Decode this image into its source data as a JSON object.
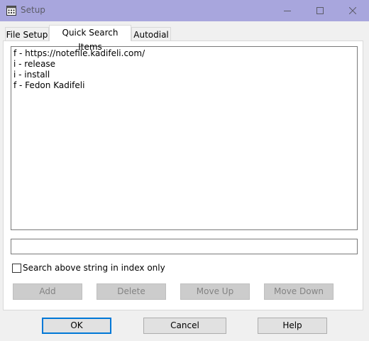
{
  "window": {
    "title": "Setup"
  },
  "tabs": {
    "file_setup": "File Setup",
    "quick_search": "Quick Search Items",
    "autodial": "Autodial"
  },
  "quick_search_items": [
    "f - https://notefile.kadifeli.com/",
    "i - release",
    "i - install",
    "f - Fedon Kadifeli"
  ],
  "search_field": {
    "value": ""
  },
  "index_only_checkbox": {
    "label": "Search above string in index only",
    "checked": false
  },
  "item_buttons": {
    "add": "Add",
    "delete": "Delete",
    "move_up": "Move Up",
    "move_down": "Move Down"
  },
  "dialog_buttons": {
    "ok": "OK",
    "cancel": "Cancel",
    "help": "Help"
  },
  "colors": {
    "titlebar": "#a8a6dd",
    "focus_border": "#0078d7",
    "disabled_button": "#cccccc"
  }
}
